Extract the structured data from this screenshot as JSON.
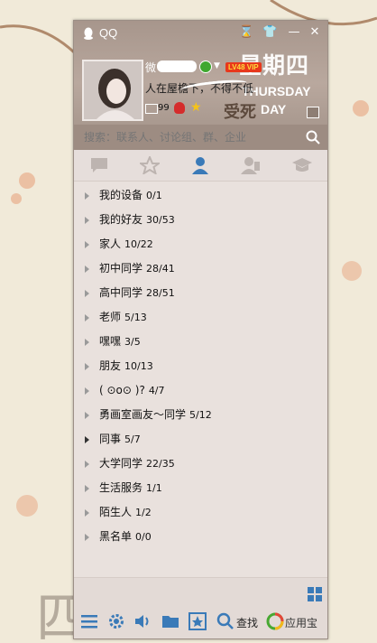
{
  "window": {
    "title": "QQ"
  },
  "profile": {
    "nickname": "微",
    "vip_badge": "LV48 VIP",
    "signature": "人在屋檐下，不得不低",
    "mail_count": "99"
  },
  "skin": {
    "day_cn": "星期四",
    "day_en": "THURSDAY",
    "day_cn2": "受死",
    "day_en2": "DAY"
  },
  "search": {
    "placeholder": "搜索：联系人、讨论组、群、企业"
  },
  "tabs": [
    {
      "name": "conversations",
      "icon": "chat-bubble-icon"
    },
    {
      "name": "favorites",
      "icon": "star-icon"
    },
    {
      "name": "contacts",
      "icon": "person-icon",
      "active": true
    },
    {
      "name": "groups",
      "icon": "group-icon"
    },
    {
      "name": "school",
      "icon": "graduation-cap-icon"
    }
  ],
  "groups": [
    {
      "label": "我的设备",
      "count": "0/1"
    },
    {
      "label": "我的好友",
      "count": "30/53"
    },
    {
      "label": "家人",
      "count": "10/22"
    },
    {
      "label": "初中同学",
      "count": "28/41"
    },
    {
      "label": "高中同学",
      "count": "28/51"
    },
    {
      "label": "老师",
      "count": "5/13"
    },
    {
      "label": "嘿嘿",
      "count": "3/5"
    },
    {
      "label": "朋友",
      "count": "10/13"
    },
    {
      "label": "( ⊙o⊙ )?",
      "count": "4/7"
    },
    {
      "label": "勇画室画友～同学",
      "count": "5/12"
    },
    {
      "label": "同事",
      "count": "5/7"
    },
    {
      "label": "大学同学",
      "count": "22/35"
    },
    {
      "label": "生活服务",
      "count": "1/1"
    },
    {
      "label": "陌生人",
      "count": "1/2"
    },
    {
      "label": "黑名单",
      "count": "0/0"
    }
  ],
  "bottom": {
    "find_label": "查找",
    "app_center_label": "应用宝"
  },
  "colors": {
    "accent": "#3a7ab8",
    "header": "#a7968c",
    "search_bg": "#9d8c82"
  }
}
